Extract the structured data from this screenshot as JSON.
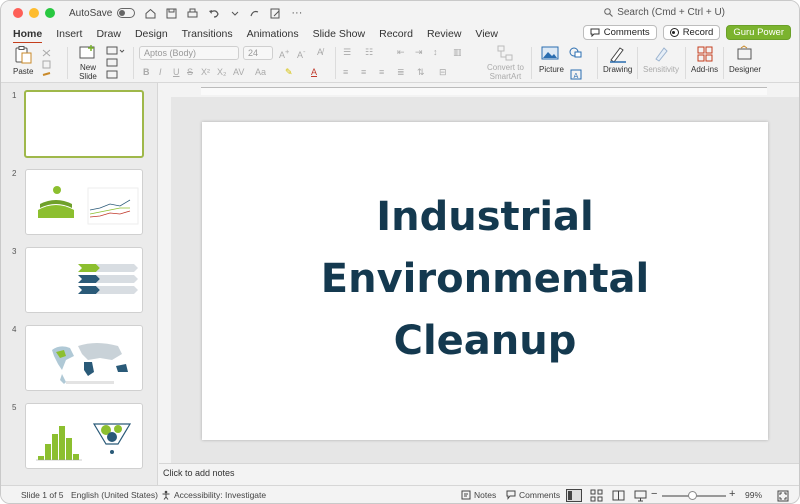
{
  "titlebar": {
    "autosave_label": "AutoSave",
    "search_placeholder": "Search (Cmd + Ctrl + U)"
  },
  "tabs": [
    {
      "label": "Home",
      "active": true
    },
    {
      "label": "Insert"
    },
    {
      "label": "Draw"
    },
    {
      "label": "Design"
    },
    {
      "label": "Transitions"
    },
    {
      "label": "Animations"
    },
    {
      "label": "Slide Show"
    },
    {
      "label": "Record"
    },
    {
      "label": "Review"
    },
    {
      "label": "View"
    }
  ],
  "header_buttons": {
    "comments": "Comments",
    "record": "Record",
    "guru": "Guru Power"
  },
  "ribbon": {
    "paste": "Paste",
    "new_slide_line1": "New",
    "new_slide_line2": "Slide",
    "font_name": "Aptos (Body)",
    "font_size": "24",
    "convert_line1": "Convert to",
    "convert_line2": "SmartArt",
    "picture": "Picture",
    "drawing": "Drawing",
    "sensitivity": "Sensitivity",
    "addins": "Add-ins",
    "designer": "Designer"
  },
  "slides_panel": {
    "numbers": [
      "1",
      "2",
      "3",
      "4",
      "5"
    ],
    "selected_index": 1
  },
  "slide": {
    "title_lines": [
      "Industrial",
      "Environmental",
      "Cleanup"
    ],
    "title_color": "#14394f"
  },
  "notes": {
    "placeholder": "Click to add notes"
  },
  "status": {
    "slide_counter": "Slide 1 of 5",
    "language": "English (United States)",
    "accessibility": "Accessibility: Investigate",
    "notes": "Notes",
    "comments": "Comments",
    "zoom": "99%"
  },
  "colors": {
    "accent_green": "#7bb32e",
    "selection_border": "#9fb84a",
    "active_tab_underline": "#c43e1c",
    "thumb_navy": "#2a5a78",
    "thumb_green": "#8cbf2f"
  }
}
